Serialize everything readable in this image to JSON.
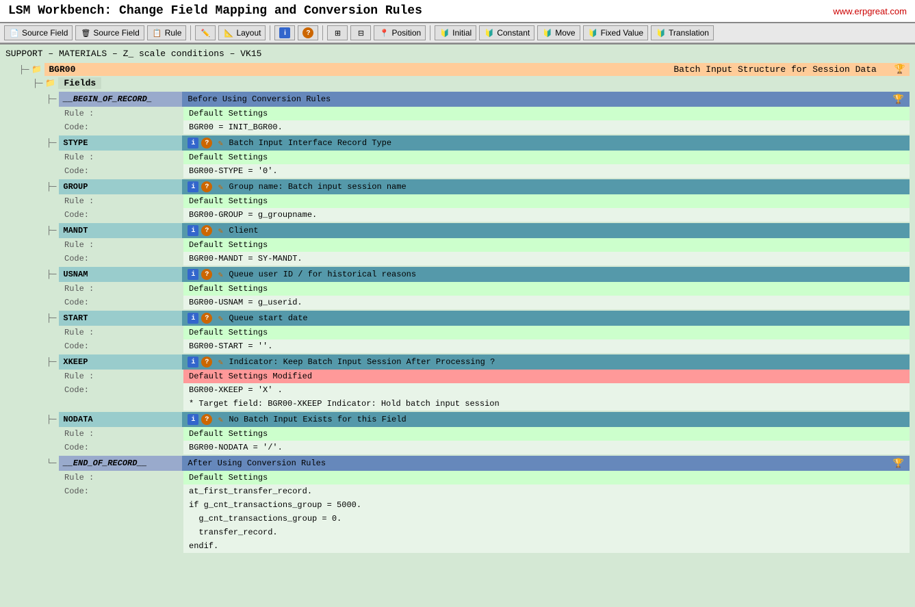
{
  "title": "LSM Workbench: Change Field Mapping and Conversion Rules",
  "url": "www.erpgreat.com",
  "toolbar": {
    "buttons": [
      {
        "label": "Source Field",
        "icon": "📄",
        "name": "source-field-btn-1"
      },
      {
        "label": "Source Field",
        "icon": "🗑",
        "name": "source-field-btn-2"
      },
      {
        "label": "Rule",
        "icon": "📋",
        "name": "rule-btn"
      },
      {
        "label": "",
        "icon": "✏️",
        "name": "edit-btn"
      },
      {
        "label": "Layout",
        "icon": "📐",
        "name": "layout-btn"
      },
      {
        "label": "",
        "icon": "ℹ",
        "name": "info-btn"
      },
      {
        "label": "",
        "icon": "❓",
        "name": "help-btn"
      },
      {
        "label": "",
        "icon": "⊞",
        "name": "grid-btn-1"
      },
      {
        "label": "",
        "icon": "⊟",
        "name": "grid-btn-2"
      },
      {
        "label": "Position",
        "icon": "📍",
        "name": "position-btn"
      },
      {
        "label": "Initial",
        "icon": "🔰",
        "name": "initial-btn"
      },
      {
        "label": "Constant",
        "icon": "🔰",
        "name": "constant-btn"
      },
      {
        "label": "Move",
        "icon": "🔰",
        "name": "move-btn"
      },
      {
        "label": "Fixed Value",
        "icon": "🔰",
        "name": "fixed-value-btn"
      },
      {
        "label": "Translation",
        "icon": "🔰",
        "name": "translation-btn"
      }
    ]
  },
  "breadcrumb": "SUPPORT – MATERIALS – Z_                    scale conditions – VK15",
  "bgr00": {
    "name": "BGR00",
    "description": "Batch Input Structure for Session Data"
  },
  "fields_label": "Fields",
  "fields": [
    {
      "name": "__BEGIN_OF_RECORD_",
      "type": "begin-end",
      "description": "Before Using Conversion Rules",
      "desc_bg": "blue",
      "rule": "Default Settings",
      "rule_type": "green",
      "code": "BGR00 = INIT_BGR00.",
      "has_icons": false,
      "has_trophy": true
    },
    {
      "name": "STYPE",
      "type": "normal",
      "description": "Batch Input Interface Record Type",
      "desc_bg": "teal",
      "rule": "Default Settings",
      "rule_type": "green",
      "code": "BGR00-STYPE = '0'.",
      "has_icons": true,
      "has_trophy": false
    },
    {
      "name": "GROUP",
      "type": "normal",
      "description": "Group name: Batch input session name",
      "desc_bg": "teal",
      "rule": "Default Settings",
      "rule_type": "green",
      "code": "BGR00-GROUP = g_groupname.",
      "has_icons": true,
      "has_trophy": false
    },
    {
      "name": "MANDT",
      "type": "normal",
      "description": "Client",
      "desc_bg": "teal",
      "rule": "Default Settings",
      "rule_type": "green",
      "code": "BGR00-MANDT = SY-MANDT.",
      "has_icons": true,
      "has_trophy": false
    },
    {
      "name": "USNAM",
      "type": "normal",
      "description": "Queue user ID / for historical reasons",
      "desc_bg": "teal",
      "rule": "Default Settings",
      "rule_type": "green",
      "code": "BGR00-USNAM = g_userid.",
      "has_icons": true,
      "has_trophy": false
    },
    {
      "name": "START",
      "type": "normal",
      "description": "Queue start date",
      "desc_bg": "teal",
      "rule": "Default Settings",
      "rule_type": "green",
      "code": "BGR00-START = ''.",
      "has_icons": true,
      "has_trophy": false
    },
    {
      "name": "XKEEP",
      "type": "normal",
      "description": "Indicator: Keep Batch Input Session After Processing ?",
      "desc_bg": "teal",
      "rule": "Default Settings Modified",
      "rule_type": "red",
      "code": " BGR00-XKEEP = 'X' .",
      "extra_line": "* Target field: BGR00-XKEEP Indicator: Hold batch input session",
      "has_icons": true,
      "has_trophy": false
    },
    {
      "name": "NODATA",
      "type": "normal",
      "description": "No Batch Input Exists for this Field",
      "desc_bg": "teal",
      "rule": "Default Settings",
      "rule_type": "green",
      "code": "BGR00-NODATA = '/'.",
      "has_icons": true,
      "has_trophy": false
    },
    {
      "name": "__END_OF_RECORD__",
      "type": "begin-end",
      "description": "After Using Conversion Rules",
      "desc_bg": "blue",
      "rule": "Default Settings",
      "rule_type": "green",
      "code": "at_first_transfer_record.",
      "extra_lines": [
        "if g_cnt_transactions_group = 5000.",
        "  g_cnt_transactions_group = 0.",
        "  transfer_record.",
        "endif."
      ],
      "has_icons": false,
      "has_trophy": true
    }
  ]
}
